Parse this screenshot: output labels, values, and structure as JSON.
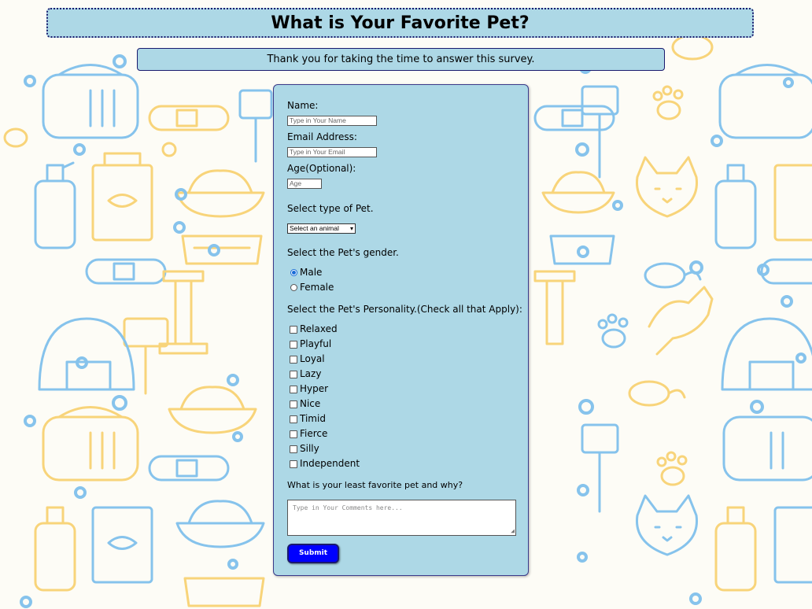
{
  "header": {
    "title": "What is Your Favorite Pet?"
  },
  "subheader": {
    "text": "Thank you for taking the time to answer this survey."
  },
  "form": {
    "name_label": "Name:",
    "name_placeholder": "Type in Your Name",
    "email_label": "Email Address:",
    "email_placeholder": "Type in Your Email",
    "age_label": "Age(Optional):",
    "age_placeholder": "Age",
    "pet_type_label": "Select type of Pet.",
    "pet_type_selected": "Select an animal",
    "gender_label": "Select the Pet's gender.",
    "genders": [
      {
        "label": "Male",
        "checked": true
      },
      {
        "label": "Female",
        "checked": false
      }
    ],
    "personality_label": "Select the Pet's Personality.(Check all that Apply):",
    "personalities": [
      "Relaxed",
      "Playful",
      "Loyal",
      "Lazy",
      "Hyper",
      "Nice",
      "Timid",
      "Fierce",
      "Silly",
      "Independent"
    ],
    "comments_label": "What is your least favorite pet and why?",
    "comments_placeholder": "Type in Your Comments here...",
    "submit_label": "Submit"
  },
  "colors": {
    "panel": "#add8e6",
    "submit": "#0000ff",
    "pattern_yellow": "#f8d47a",
    "pattern_blue": "#86c3ec"
  },
  "icons": [
    "cat-icon",
    "food-bowl-icon",
    "pet-carrier-icon",
    "collar-icon",
    "brush-icon",
    "paw-icon",
    "litter-box-icon",
    "mouse-toy-icon",
    "spray-bottle-icon",
    "food-bag-icon",
    "bubble-icon"
  ]
}
